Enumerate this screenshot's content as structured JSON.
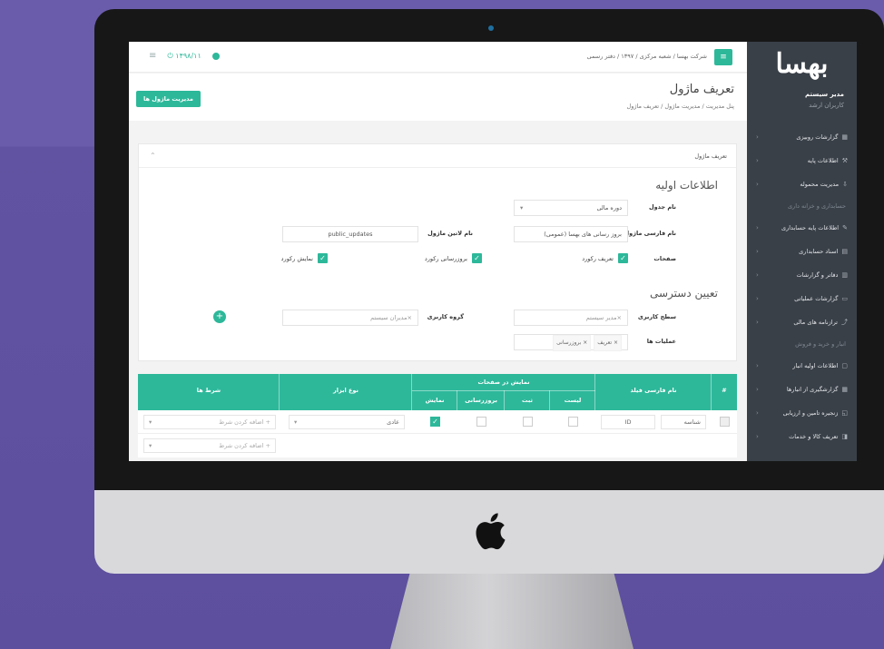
{
  "topbar": {
    "breadcrumb": "شرکت بهسا / شعبه مرکزی / ۱۳۹۷ / دفتر رسمی",
    "date": "۱۴۹۸/۱۱"
  },
  "sidebar": {
    "brand": "بهسا",
    "user_name": "مدیر سیستم",
    "user_role": "کاربران ارشد",
    "items": [
      {
        "label": "گزارشات روبیزی",
        "icon": "▦",
        "type": "item"
      },
      {
        "label": "اطلاعات پایه",
        "icon": "⚒",
        "type": "item"
      },
      {
        "label": "مدیریت محموله",
        "icon": "⇩",
        "type": "item"
      },
      {
        "label": "حسابداری و خزانه داری",
        "type": "header"
      },
      {
        "label": "اطلاعات پایه حسابداری",
        "icon": "✎",
        "type": "item"
      },
      {
        "label": "اسناد حسابداری",
        "icon": "▤",
        "type": "item"
      },
      {
        "label": "دفاتر و گزارشات",
        "icon": "▥",
        "type": "item"
      },
      {
        "label": "گزارشات عملیاتی",
        "icon": "▭",
        "type": "item"
      },
      {
        "label": "ترازنامه های مالی",
        "icon": "⤴",
        "type": "item"
      },
      {
        "label": "انبار و خرید و فروش",
        "type": "header"
      },
      {
        "label": "اطلاعات اولیه انبار",
        "icon": "▢",
        "type": "item"
      },
      {
        "label": "گزارشگیری از انبارها",
        "icon": "▦",
        "type": "item"
      },
      {
        "label": "زنجیره تامین و ارزیابی",
        "icon": "◱",
        "type": "item"
      },
      {
        "label": "تعریف کالا و خدمات",
        "icon": "◨",
        "type": "item"
      }
    ]
  },
  "header": {
    "title": "تعریف ماژول",
    "breadcrumb": "پنل مدیریت  /  مدیریت ماژول  /  تعریف ماژول",
    "manage_button": "مدیریت ماژول ها"
  },
  "panel": {
    "heading": "تعریف ماژول",
    "section1": "اطلاعات اولیه",
    "section2": "تعیین دسترسی",
    "table_name_label": "نام جدول",
    "table_name_value": "دوره مالی",
    "fa_name_label": "نام فارسی ماژول",
    "fa_name_value": "بروز رسانی های بهسا (عمومی)",
    "latin_name_label": "نام لاتین ماژول",
    "latin_name_value": "public_updates",
    "pages_label": "صفحات",
    "chk_define": "تعریف رکورد",
    "chk_update": "بروزرسانی رکورد",
    "chk_show": "نمایش رکورد",
    "level_label": "سطح کاربری",
    "level_value": "×مدیر سیستم",
    "group_label": "گروه کاربری",
    "group_value": "×مدیران سیستم",
    "ops_label": "عملیات ها",
    "op_tag1": "× تعریف",
    "op_tag2": "× بروزرسانی"
  },
  "table": {
    "col_num": "#",
    "col_field": "نام فارسی فیلد",
    "col_pages": "نمایش در صفحات",
    "col_list": "لیست",
    "col_insert": "ثبت",
    "col_update": "بروزرسانی",
    "col_show": "نمایش",
    "col_type": "نوع ابزار",
    "col_conditions": "شرط ها",
    "row1_field": "شناسه",
    "row1_id": "ID",
    "row1_type": "عادی",
    "add_condition": "+ اضافه کردن شرط"
  },
  "colors": {
    "accent": "#2db89a",
    "sidebar": "#3a4048",
    "frame": "#6b5cab"
  }
}
